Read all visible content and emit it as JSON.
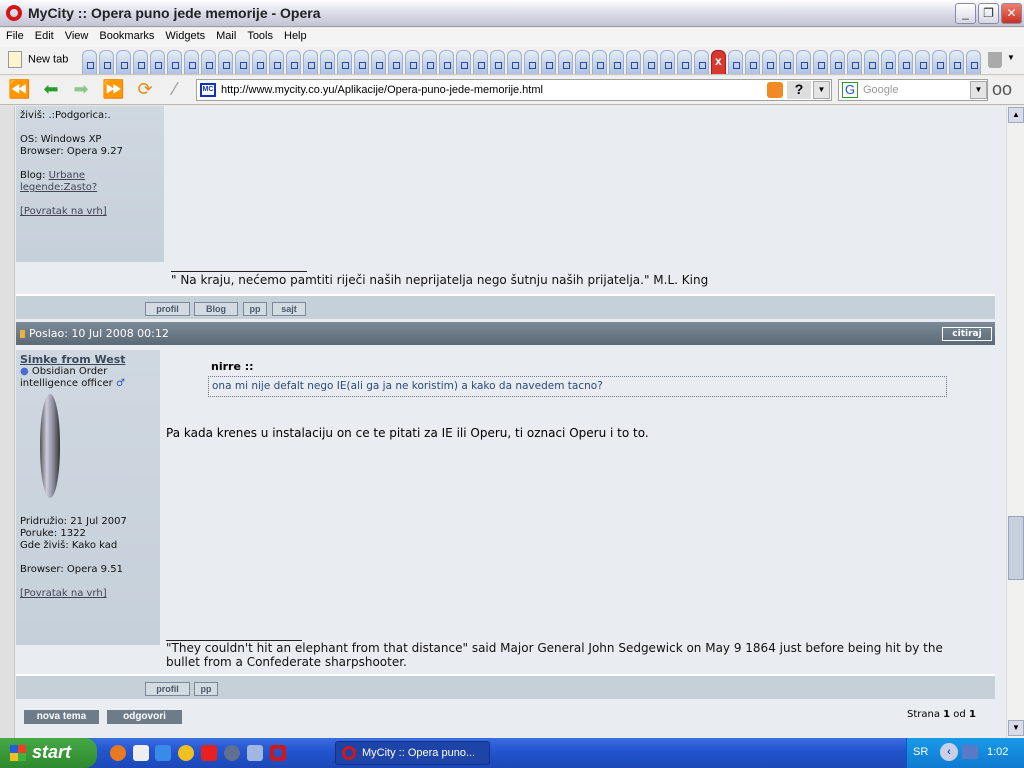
{
  "window": {
    "title": "MyCity :: Opera puno jede memorije - Opera"
  },
  "menu": [
    "File",
    "Edit",
    "View",
    "Bookmarks",
    "Widgets",
    "Mail",
    "Tools",
    "Help"
  ],
  "tabs": {
    "new_tab": "New tab",
    "count": 53,
    "active_index": 37
  },
  "address": {
    "url": "http://www.mycity.co.yu/Aplikacije/Opera-puno-jede-memorije.html",
    "site_icon": "MC",
    "search_placeholder": "Google"
  },
  "post1": {
    "profile": {
      "location": "živiš: .:Podgorica:.",
      "os": "OS: Windows XP",
      "browser": "Browser: Opera 9.27",
      "blog_label": "Blog: ",
      "blog_link_1": "Urbane",
      "blog_link_2": "legende:Zasto?",
      "back_top": "[Povratak na vrh]"
    },
    "signature": "\" Na kraju, nećemo pamtiti riječi naših neprijatelja nego šutnju naših prijatelja.\" M.L. King",
    "buttons": [
      "profil",
      "Blog",
      "pp",
      "sajt"
    ]
  },
  "post2": {
    "header": "Poslao: 10 Jul 2008 00:12",
    "quote_button": "citiraj",
    "author": "Simke from West",
    "rank_1": "Obsidian Order",
    "rank_2": "intelligence officer",
    "joined": "Pridružio: 21 Jul 2007",
    "posts": "Poruke: 1322",
    "location": "Gde živiš: Kako kad",
    "browser": "Browser: Opera 9.51",
    "back_top": "[Povratak na vrh]",
    "quote_author": "nirre ::",
    "quote_text": "ona mi nije defalt nego IE(ali ga ja ne koristim) a kako da navedem tacno?",
    "body": "Pa kada krenes u instalaciju on ce te pitati za IE ili Operu, ti oznaci Operu i to to.",
    "signature_1": "\"They couldn't hit an elephant from that distance\" said Major General John Sedgewick on May 9 1864 just before being hit by the",
    "signature_2": "bullet from a Confederate sharpshooter.",
    "buttons": [
      "profil",
      "pp"
    ]
  },
  "footer": {
    "new_topic": "nova tema",
    "reply": "odgovori",
    "page_label": "Strana ",
    "page": "1",
    "of": " od ",
    "total": "1"
  },
  "taskbar": {
    "start": "start",
    "task": "MyCity :: Opera puno...",
    "lang": "SR",
    "clock": "1:02"
  }
}
